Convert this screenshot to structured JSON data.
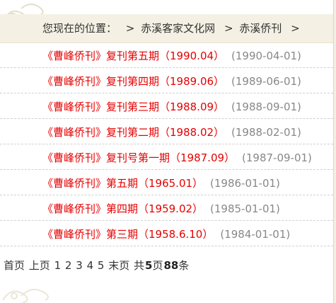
{
  "breadcrumb": {
    "prefix": "您现在的位置：",
    "items": [
      {
        "label": "赤溪客家文化网"
      },
      {
        "label": "赤溪侨刊"
      }
    ]
  },
  "articles": [
    {
      "title": "《曹峰侨刊》复刊第五期（1990.04）",
      "date": "(1990-04-01)"
    },
    {
      "title": "《曹峰侨刊》复刊第四期（1989.06）",
      "date": "(1989-06-01)"
    },
    {
      "title": "《曹峰侨刊》复刊第三期（1988.09）",
      "date": "(1988-09-01)"
    },
    {
      "title": "《曹峰侨刊》复刊第二期（1988.02）",
      "date": "(1988-02-01)"
    },
    {
      "title": "《曹峰侨刊》复刊号第一期（1987.09）",
      "date": "(1987-09-01)"
    },
    {
      "title": "《曹峰侨刊》第五期（1965.01）",
      "date": "(1986-01-01)"
    },
    {
      "title": "《曹峰侨刊》第四期（1959.02）",
      "date": "(1985-01-01)"
    },
    {
      "title": "《曹峰侨刊》第三期（1958.6.10）",
      "date": "(1984-01-01)"
    }
  ],
  "pager": {
    "first": "首页",
    "prev": "上页",
    "pages": [
      "1",
      "2",
      "3",
      "4",
      "5"
    ],
    "last": "末页",
    "total_prefix": "共",
    "total_pages": "5",
    "pages_unit": "页",
    "total_items": "88",
    "items_unit": "条"
  },
  "colors": {
    "title": "#e60000",
    "date": "#888888",
    "bar": "#f4f1e4"
  }
}
